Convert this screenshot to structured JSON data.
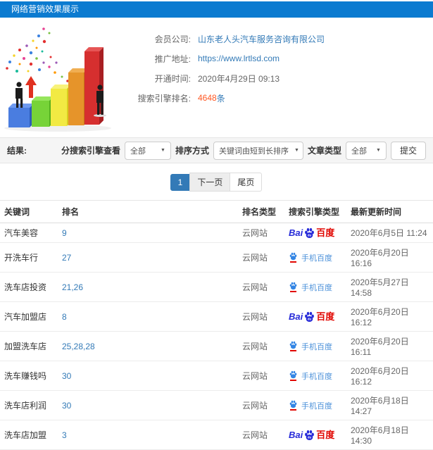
{
  "header": {
    "title": "网络营销效果展示"
  },
  "info": {
    "company_label": "会员公司:",
    "company_value": "山东老人头汽车服务咨询有限公司",
    "url_label": "推广地址:",
    "url_value": "https://www.lrtlsd.com",
    "opened_label": "开通时间:",
    "opened_value": "2020年4月29日 09:13",
    "ranking_label": "搜索引擎排名:",
    "ranking_count": "4648",
    "ranking_unit": "条"
  },
  "filters": {
    "result_label": "结果:",
    "engine_filter_label": "分搜索引擎查看",
    "engine_filter_value": "全部",
    "sort_label": "排序方式",
    "sort_value": "关键词由短到长排序",
    "article_type_label": "文章类型",
    "article_type_value": "全部",
    "submit_label": "提交"
  },
  "pagination": {
    "current_page": "1",
    "next_label": "下一页",
    "last_label": "尾页"
  },
  "table": {
    "headers": [
      "关键词",
      "排名",
      "排名类型",
      "搜索引擎类型",
      "最新更新时间"
    ],
    "rows": [
      {
        "keyword": "汽车美容",
        "rank": "9",
        "rank_type": "云网站",
        "engine": "baidu",
        "time": "2020年6月5日 11:24"
      },
      {
        "keyword": "开洗车行",
        "rank": "27",
        "rank_type": "云网站",
        "engine": "mobile_baidu",
        "time": "2020年6月20日 16:16"
      },
      {
        "keyword": "洗车店投资",
        "rank": "21,26",
        "rank_type": "云网站",
        "engine": "mobile_baidu",
        "time": "2020年5月27日 14:58"
      },
      {
        "keyword": "汽车加盟店",
        "rank": "8",
        "rank_type": "云网站",
        "engine": "baidu",
        "time": "2020年6月20日 16:12"
      },
      {
        "keyword": "加盟洗车店",
        "rank": "25,28,28",
        "rank_type": "云网站",
        "engine": "mobile_baidu",
        "time": "2020年6月20日 16:11"
      },
      {
        "keyword": "洗车赚钱吗",
        "rank": "30",
        "rank_type": "云网站",
        "engine": "mobile_baidu",
        "time": "2020年6月20日 16:12"
      },
      {
        "keyword": "洗车店利润",
        "rank": "30",
        "rank_type": "云网站",
        "engine": "mobile_baidu",
        "time": "2020年6月18日 14:27"
      },
      {
        "keyword": "洗车店加盟",
        "rank": "3",
        "rank_type": "云网站",
        "engine": "baidu",
        "time": "2020年6月18日 14:30"
      }
    ]
  },
  "engines": {
    "baidu": {
      "prefix": "Bai",
      "du": "du",
      "suffix": "百度"
    },
    "mobile_baidu": {
      "label": "手机百度"
    }
  },
  "colors": {
    "header_blue": "#0c7bd0",
    "link_blue": "#337ab7",
    "count_orange": "#ff5722",
    "baidu_blue": "#2529d8",
    "baidu_red": "#e10601"
  }
}
